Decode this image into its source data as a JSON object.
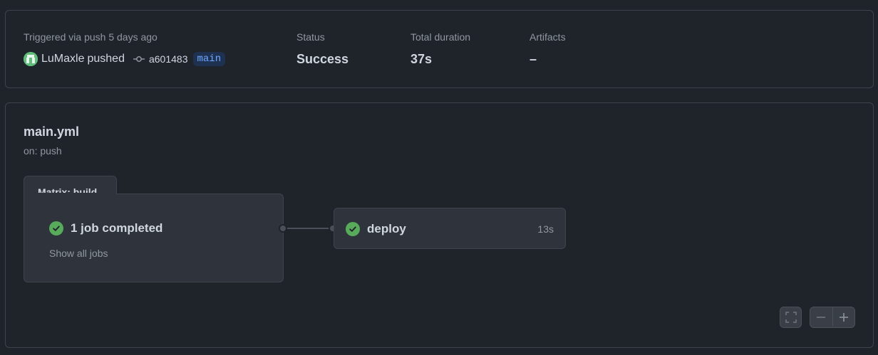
{
  "summary": {
    "trigger_label": "Triggered via push 5 days ago",
    "actor": "LuMaxle",
    "action": "pushed",
    "commit_sha": "a601483",
    "branch": "main",
    "status_label": "Status",
    "status_value": "Success",
    "duration_label": "Total duration",
    "duration_value": "37s",
    "artifacts_label": "Artifacts",
    "artifacts_value": "–"
  },
  "workflow": {
    "file_name": "main.yml",
    "trigger": "on: push",
    "matrix": {
      "tab_label": "Matrix: build",
      "summary": "1 job completed",
      "show_all": "Show all jobs"
    },
    "jobs": [
      {
        "name": "deploy",
        "duration": "13s",
        "status": "success"
      }
    ]
  },
  "icons": {
    "success": "check-circle-icon",
    "commit": "git-commit-icon",
    "fullscreen": "fullscreen-icon",
    "zoom_out": "minus-icon",
    "zoom_in": "plus-icon"
  },
  "colors": {
    "success": "#57ab5a",
    "branch_bg": "#1f3150",
    "branch_fg": "#6fa8ff",
    "background": "#1f232a"
  }
}
